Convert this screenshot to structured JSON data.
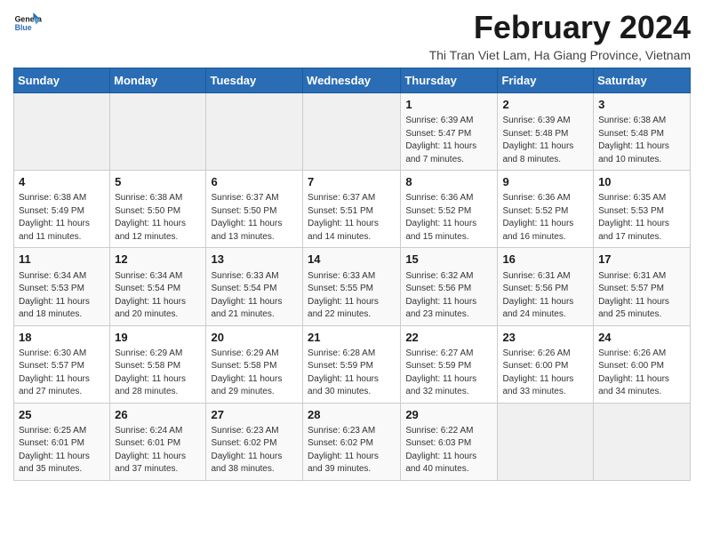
{
  "header": {
    "title": "February 2024",
    "subtitle": "Thi Tran Viet Lam, Ha Giang Province, Vietnam"
  },
  "calendar": {
    "headers": [
      "Sunday",
      "Monday",
      "Tuesday",
      "Wednesday",
      "Thursday",
      "Friday",
      "Saturday"
    ],
    "weeks": [
      [
        {
          "day": "",
          "info": ""
        },
        {
          "day": "",
          "info": ""
        },
        {
          "day": "",
          "info": ""
        },
        {
          "day": "",
          "info": ""
        },
        {
          "day": "1",
          "info": "Sunrise: 6:39 AM\nSunset: 5:47 PM\nDaylight: 11 hours\nand 7 minutes."
        },
        {
          "day": "2",
          "info": "Sunrise: 6:39 AM\nSunset: 5:48 PM\nDaylight: 11 hours\nand 8 minutes."
        },
        {
          "day": "3",
          "info": "Sunrise: 6:38 AM\nSunset: 5:48 PM\nDaylight: 11 hours\nand 10 minutes."
        }
      ],
      [
        {
          "day": "4",
          "info": "Sunrise: 6:38 AM\nSunset: 5:49 PM\nDaylight: 11 hours\nand 11 minutes."
        },
        {
          "day": "5",
          "info": "Sunrise: 6:38 AM\nSunset: 5:50 PM\nDaylight: 11 hours\nand 12 minutes."
        },
        {
          "day": "6",
          "info": "Sunrise: 6:37 AM\nSunset: 5:50 PM\nDaylight: 11 hours\nand 13 minutes."
        },
        {
          "day": "7",
          "info": "Sunrise: 6:37 AM\nSunset: 5:51 PM\nDaylight: 11 hours\nand 14 minutes."
        },
        {
          "day": "8",
          "info": "Sunrise: 6:36 AM\nSunset: 5:52 PM\nDaylight: 11 hours\nand 15 minutes."
        },
        {
          "day": "9",
          "info": "Sunrise: 6:36 AM\nSunset: 5:52 PM\nDaylight: 11 hours\nand 16 minutes."
        },
        {
          "day": "10",
          "info": "Sunrise: 6:35 AM\nSunset: 5:53 PM\nDaylight: 11 hours\nand 17 minutes."
        }
      ],
      [
        {
          "day": "11",
          "info": "Sunrise: 6:34 AM\nSunset: 5:53 PM\nDaylight: 11 hours\nand 18 minutes."
        },
        {
          "day": "12",
          "info": "Sunrise: 6:34 AM\nSunset: 5:54 PM\nDaylight: 11 hours\nand 20 minutes."
        },
        {
          "day": "13",
          "info": "Sunrise: 6:33 AM\nSunset: 5:54 PM\nDaylight: 11 hours\nand 21 minutes."
        },
        {
          "day": "14",
          "info": "Sunrise: 6:33 AM\nSunset: 5:55 PM\nDaylight: 11 hours\nand 22 minutes."
        },
        {
          "day": "15",
          "info": "Sunrise: 6:32 AM\nSunset: 5:56 PM\nDaylight: 11 hours\nand 23 minutes."
        },
        {
          "day": "16",
          "info": "Sunrise: 6:31 AM\nSunset: 5:56 PM\nDaylight: 11 hours\nand 24 minutes."
        },
        {
          "day": "17",
          "info": "Sunrise: 6:31 AM\nSunset: 5:57 PM\nDaylight: 11 hours\nand 25 minutes."
        }
      ],
      [
        {
          "day": "18",
          "info": "Sunrise: 6:30 AM\nSunset: 5:57 PM\nDaylight: 11 hours\nand 27 minutes."
        },
        {
          "day": "19",
          "info": "Sunrise: 6:29 AM\nSunset: 5:58 PM\nDaylight: 11 hours\nand 28 minutes."
        },
        {
          "day": "20",
          "info": "Sunrise: 6:29 AM\nSunset: 5:58 PM\nDaylight: 11 hours\nand 29 minutes."
        },
        {
          "day": "21",
          "info": "Sunrise: 6:28 AM\nSunset: 5:59 PM\nDaylight: 11 hours\nand 30 minutes."
        },
        {
          "day": "22",
          "info": "Sunrise: 6:27 AM\nSunset: 5:59 PM\nDaylight: 11 hours\nand 32 minutes."
        },
        {
          "day": "23",
          "info": "Sunrise: 6:26 AM\nSunset: 6:00 PM\nDaylight: 11 hours\nand 33 minutes."
        },
        {
          "day": "24",
          "info": "Sunrise: 6:26 AM\nSunset: 6:00 PM\nDaylight: 11 hours\nand 34 minutes."
        }
      ],
      [
        {
          "day": "25",
          "info": "Sunrise: 6:25 AM\nSunset: 6:01 PM\nDaylight: 11 hours\nand 35 minutes."
        },
        {
          "day": "26",
          "info": "Sunrise: 6:24 AM\nSunset: 6:01 PM\nDaylight: 11 hours\nand 37 minutes."
        },
        {
          "day": "27",
          "info": "Sunrise: 6:23 AM\nSunset: 6:02 PM\nDaylight: 11 hours\nand 38 minutes."
        },
        {
          "day": "28",
          "info": "Sunrise: 6:23 AM\nSunset: 6:02 PM\nDaylight: 11 hours\nand 39 minutes."
        },
        {
          "day": "29",
          "info": "Sunrise: 6:22 AM\nSunset: 6:03 PM\nDaylight: 11 hours\nand 40 minutes."
        },
        {
          "day": "",
          "info": ""
        },
        {
          "day": "",
          "info": ""
        }
      ]
    ]
  }
}
